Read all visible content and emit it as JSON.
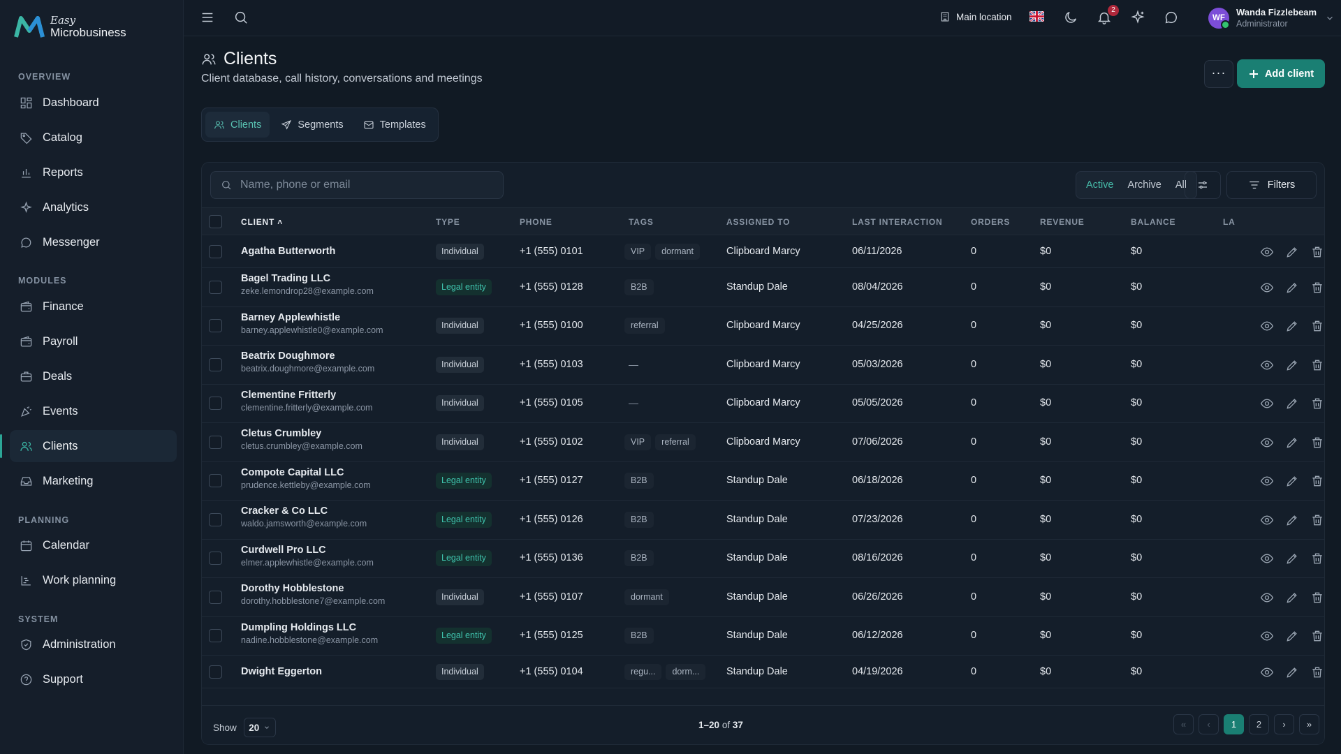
{
  "brand": {
    "line1": "Easy",
    "line2": "Microbusiness",
    "accent": "#1a7f73"
  },
  "sidebar": {
    "sections": {
      "overview": "OVERVIEW",
      "modules": "MODULES",
      "planning": "PLANNING",
      "system": "SYSTEM"
    },
    "items": [
      {
        "label": "Dashboard",
        "icon": "dashboard-icon"
      },
      {
        "label": "Catalog",
        "icon": "tag-icon"
      },
      {
        "label": "Reports",
        "icon": "bar-chart-icon"
      },
      {
        "label": "Analytics",
        "icon": "sparkle-icon"
      },
      {
        "label": "Messenger",
        "icon": "chat-icon"
      },
      {
        "label": "Finance",
        "icon": "wallet-icon"
      },
      {
        "label": "Payroll",
        "icon": "wallet-icon"
      },
      {
        "label": "Deals",
        "icon": "briefcase-icon"
      },
      {
        "label": "Events",
        "icon": "party-icon"
      },
      {
        "label": "Clients",
        "icon": "users-icon",
        "active": true
      },
      {
        "label": "Marketing",
        "icon": "inbox-icon"
      },
      {
        "label": "Calendar",
        "icon": "calendar-icon"
      },
      {
        "label": "Work planning",
        "icon": "gantt-icon"
      },
      {
        "label": "Administration",
        "icon": "shield-icon"
      },
      {
        "label": "Support",
        "icon": "help-icon"
      }
    ]
  },
  "topbar": {
    "location": "Main location",
    "notifications": "2",
    "user": {
      "initials": "WF",
      "name": "Wanda Fizzlebeam",
      "role": "Administrator"
    }
  },
  "page": {
    "title": "Clients",
    "subtitle": "Client database, call history, conversations and meetings",
    "more": "···",
    "add": "Add client"
  },
  "tabs": [
    "Clients",
    "Segments",
    "Templates"
  ],
  "toolbar": {
    "search_placeholder": "Name, phone or email",
    "seg": [
      "Active",
      "Archive",
      "All"
    ],
    "filters": "Filters"
  },
  "table": {
    "headers": {
      "client": "CLIENT",
      "type": "TYPE",
      "phone": "PHONE",
      "tags": "TAGS",
      "assigned": "ASSIGNED TO",
      "last": "LAST INTERACTION",
      "orders": "ORDERS",
      "revenue": "REVENUE",
      "balance": "BALANCE",
      "la": "LA"
    },
    "sort_arrow": "˄",
    "rows": [
      {
        "name": "Agatha Butterworth",
        "email": "",
        "type": "Individual",
        "phone": "+1 (555) 0101",
        "tags": [
          "VIP",
          "dormant"
        ],
        "assigned": "Clipboard Marcy",
        "last": "06/11/2026",
        "orders": "0",
        "revenue": "$0",
        "balance": "$0"
      },
      {
        "name": "Bagel Trading LLC",
        "email": "zeke.lemondrop28@example.com",
        "type": "Legal entity",
        "phone": "+1 (555) 0128",
        "tags": [
          "B2B"
        ],
        "assigned": "Standup Dale",
        "last": "08/04/2026",
        "orders": "0",
        "revenue": "$0",
        "balance": "$0"
      },
      {
        "name": "Barney Applewhistle",
        "email": "barney.applewhistle0@example.com",
        "type": "Individual",
        "phone": "+1 (555) 0100",
        "tags": [
          "referral"
        ],
        "assigned": "Clipboard Marcy",
        "last": "04/25/2026",
        "orders": "0",
        "revenue": "$0",
        "balance": "$0"
      },
      {
        "name": "Beatrix Doughmore",
        "email": "beatrix.doughmore@example.com",
        "type": "Individual",
        "phone": "+1 (555) 0103",
        "tags": [],
        "assigned": "Clipboard Marcy",
        "last": "05/03/2026",
        "orders": "0",
        "revenue": "$0",
        "balance": "$0"
      },
      {
        "name": "Clementine Fritterly",
        "email": "clementine.fritterly@example.com",
        "type": "Individual",
        "phone": "+1 (555) 0105",
        "tags": [],
        "assigned": "Clipboard Marcy",
        "last": "05/05/2026",
        "orders": "0",
        "revenue": "$0",
        "balance": "$0"
      },
      {
        "name": "Cletus Crumbley",
        "email": "cletus.crumbley@example.com",
        "type": "Individual",
        "phone": "+1 (555) 0102",
        "tags": [
          "VIP",
          "referral"
        ],
        "assigned": "Clipboard Marcy",
        "last": "07/06/2026",
        "orders": "0",
        "revenue": "$0",
        "balance": "$0"
      },
      {
        "name": "Compote Capital LLC",
        "email": "prudence.kettleby@example.com",
        "type": "Legal entity",
        "phone": "+1 (555) 0127",
        "tags": [
          "B2B"
        ],
        "assigned": "Standup Dale",
        "last": "06/18/2026",
        "orders": "0",
        "revenue": "$0",
        "balance": "$0"
      },
      {
        "name": "Cracker & Co LLC",
        "email": "waldo.jamsworth@example.com",
        "type": "Legal entity",
        "phone": "+1 (555) 0126",
        "tags": [
          "B2B"
        ],
        "assigned": "Standup Dale",
        "last": "07/23/2026",
        "orders": "0",
        "revenue": "$0",
        "balance": "$0"
      },
      {
        "name": "Curdwell Pro LLC",
        "email": "elmer.applewhistle@example.com",
        "type": "Legal entity",
        "phone": "+1 (555) 0136",
        "tags": [
          "B2B"
        ],
        "assigned": "Standup Dale",
        "last": "08/16/2026",
        "orders": "0",
        "revenue": "$0",
        "balance": "$0"
      },
      {
        "name": "Dorothy Hobblestone",
        "email": "dorothy.hobblestone7@example.com",
        "type": "Individual",
        "phone": "+1 (555) 0107",
        "tags": [
          "dormant"
        ],
        "assigned": "Standup Dale",
        "last": "06/26/2026",
        "orders": "0",
        "revenue": "$0",
        "balance": "$0"
      },
      {
        "name": "Dumpling Holdings LLC",
        "email": "nadine.hobblestone@example.com",
        "type": "Legal entity",
        "phone": "+1 (555) 0125",
        "tags": [
          "B2B"
        ],
        "assigned": "Standup Dale",
        "last": "06/12/2026",
        "orders": "0",
        "revenue": "$0",
        "balance": "$0"
      },
      {
        "name": "Dwight Eggerton",
        "email": "",
        "type": "Individual",
        "phone": "+1 (555) 0104",
        "tags": [
          "regu...",
          "dorm..."
        ],
        "assigned": "Standup Dale",
        "last": "04/19/2026",
        "orders": "0",
        "revenue": "$0",
        "balance": "$0"
      }
    ],
    "empty_tag": "—"
  },
  "footer": {
    "show": "Show",
    "per_page": "20",
    "range": "1–20",
    "of": "of",
    "total": "37",
    "pages": [
      "«",
      "‹",
      "1",
      "2",
      "›",
      "»"
    ]
  }
}
